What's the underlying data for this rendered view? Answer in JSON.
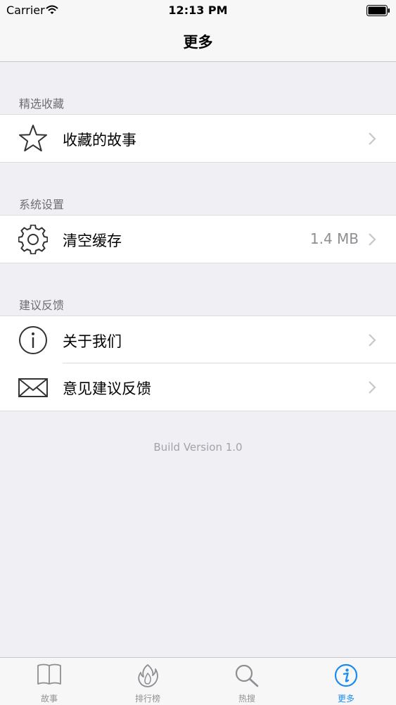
{
  "status_bar": {
    "carrier": "Carrier",
    "time": "12:13 PM"
  },
  "nav": {
    "title": "更多"
  },
  "sections": [
    {
      "header": "精选收藏",
      "items": [
        {
          "label": "收藏的故事",
          "icon": "star-icon",
          "detail": ""
        }
      ]
    },
    {
      "header": "系统设置",
      "items": [
        {
          "label": "清空缓存",
          "icon": "gear-icon",
          "detail": "1.4 MB"
        }
      ]
    },
    {
      "header": "建议反馈",
      "items": [
        {
          "label": "关于我们",
          "icon": "info-icon",
          "detail": ""
        },
        {
          "label": "意见建议反馈",
          "icon": "envelope-icon",
          "detail": ""
        }
      ]
    }
  ],
  "footer": {
    "build_version": "Build Version 1.0"
  },
  "tab_bar": {
    "tabs": [
      {
        "label": "故事",
        "icon": "book-icon",
        "active": false
      },
      {
        "label": "排行榜",
        "icon": "flame-icon",
        "active": false
      },
      {
        "label": "热搜",
        "icon": "search-icon",
        "active": false
      },
      {
        "label": "更多",
        "icon": "info-icon",
        "active": true
      }
    ],
    "active_color": "#1a8cf0",
    "inactive_color": "#929292"
  }
}
